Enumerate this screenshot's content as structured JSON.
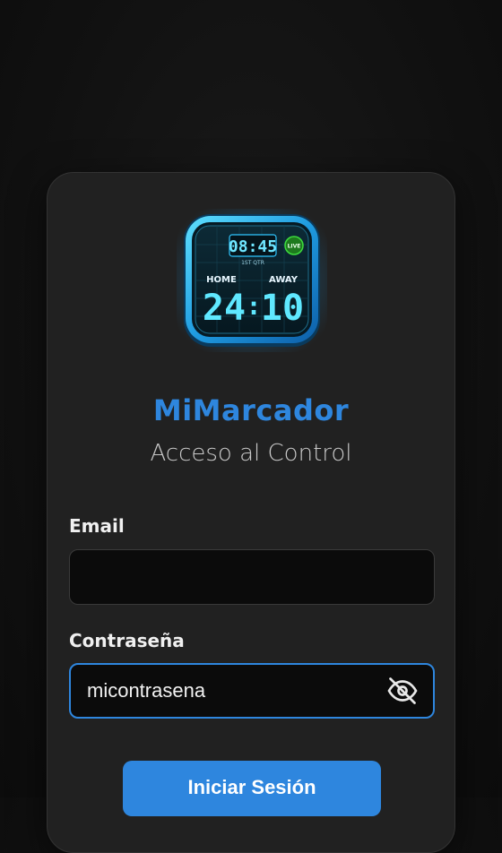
{
  "app": {
    "name": "MiMarcador",
    "subtitle": "Acceso al Control"
  },
  "logo": {
    "clock": "08:45",
    "period": "1ST QTR",
    "live": "LIVE",
    "home_label": "HOME",
    "away_label": "AWAY",
    "home_score": "24",
    "away_score": "10",
    "separator": ":"
  },
  "form": {
    "email_label": "Email",
    "email_value": "",
    "password_label": "Contraseña",
    "password_value": "micontrasena",
    "submit_label": "Iniciar Sesión"
  },
  "icons": {
    "password_toggle": "eye-off-icon"
  },
  "colors": {
    "accent": "#2e86de",
    "card": "#212121",
    "background": "#111111",
    "logo_glow": "#2fc6ff",
    "live_green": "#3ddc3d"
  }
}
